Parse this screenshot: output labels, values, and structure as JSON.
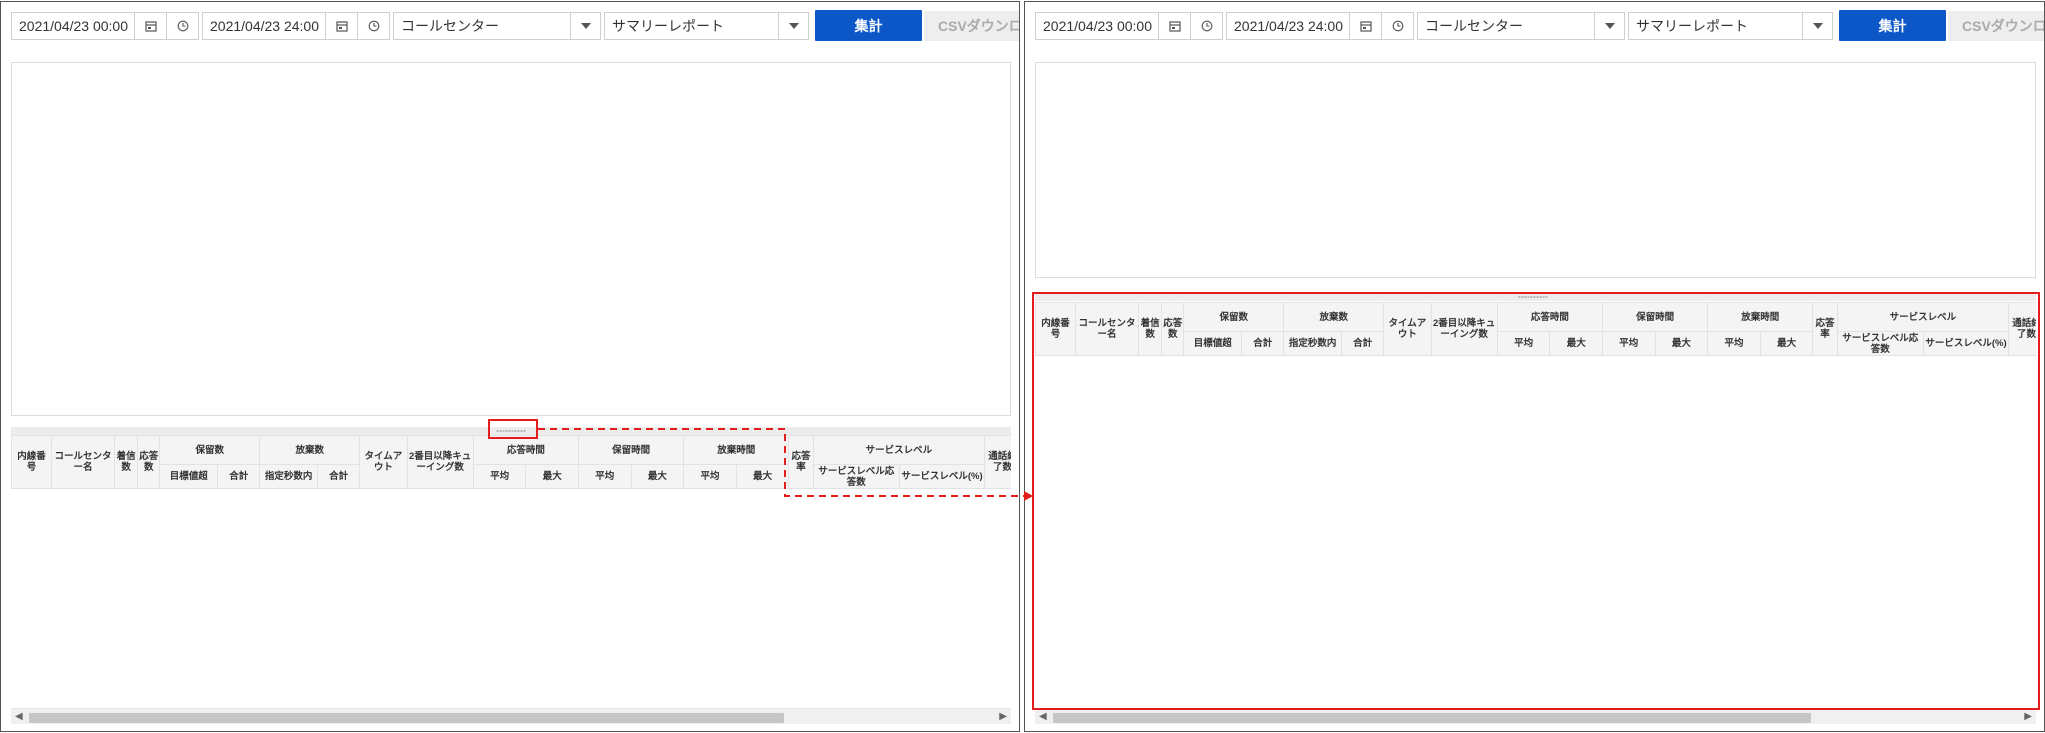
{
  "toolbar": {
    "start_datetime": "2021/04/23 00:00",
    "end_datetime": "2021/04/23 24:00",
    "center_select": "コールセンター",
    "report_select": "サマリーレポート",
    "aggregate_button": "集計",
    "csv_button": "CSVダウンロード"
  },
  "table_header": {
    "extension_number": "内線番号",
    "call_center_name": "コールセンター名",
    "incoming_count": "着信数",
    "answered_count": "応答数",
    "hold_count": "保留数",
    "hold_target": "目標値超",
    "hold_total": "合計",
    "abandon_count": "放棄数",
    "abandon_within": "指定秒数内",
    "abandon_total": "合計",
    "timeout": "タイムアウト",
    "second_queuing": "2番目以降キューイング数",
    "answer_time": "応答時間",
    "hold_time": "保留時間",
    "abandon_time": "放棄時間",
    "avg": "平均",
    "max": "最大",
    "answer_rate": "応答率",
    "service_level": "サービスレベル",
    "sl_answered": "サービスレベル応答数",
    "sl_percent": "サービスレベル(%)",
    "call_end": "通話終了数"
  },
  "colors": {
    "primary_button": "#0b57c8",
    "highlight": "#e51c1c",
    "header_bg": "#f4f4f4"
  },
  "icons": {
    "calendar": "calendar-icon",
    "clock": "clock-icon",
    "dropdown": "chevron-down-icon",
    "scroll_left": "scroll-left-arrow-icon",
    "scroll_right": "scroll-right-arrow-icon"
  }
}
